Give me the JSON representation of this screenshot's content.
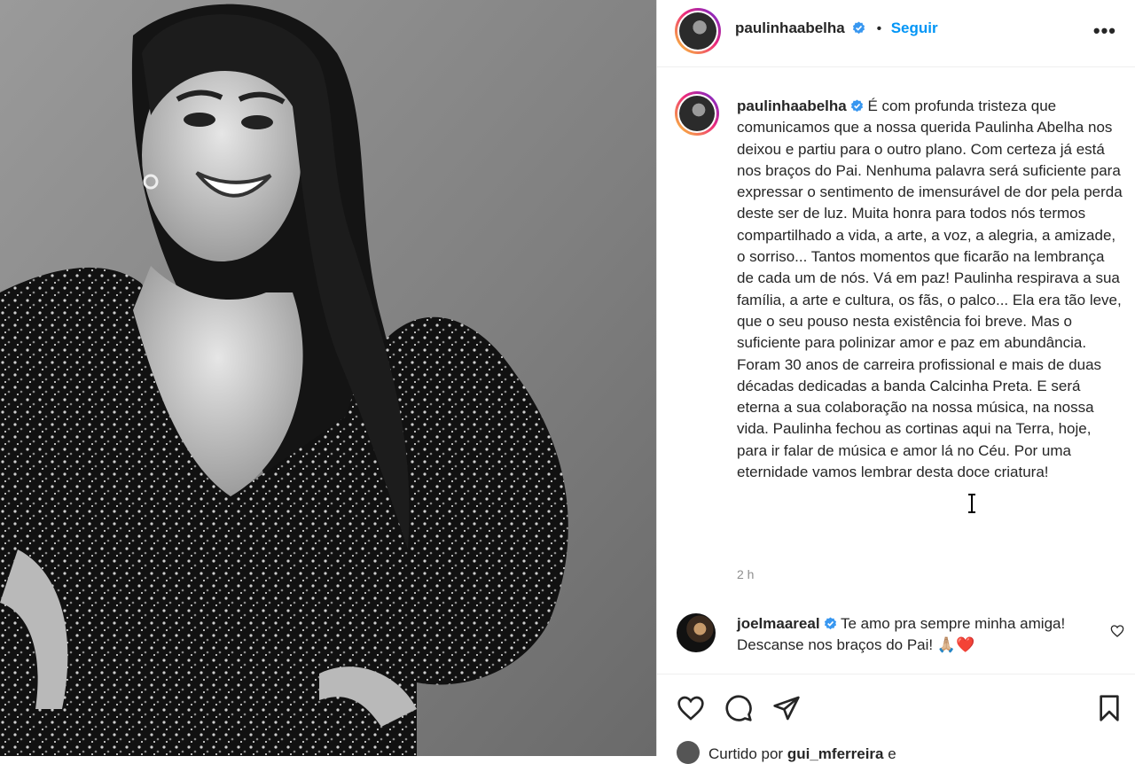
{
  "header": {
    "username": "paulinhaabelha",
    "separator": "•",
    "follow_label": "Seguir",
    "more_label": "•••"
  },
  "caption": {
    "username": "paulinhaabelha",
    "text": "É com profunda tristeza que comunicamos que a nossa querida Paulinha Abelha nos deixou e partiu para o outro plano. Com certeza já está nos braços do Pai. Nenhuma palavra será suficiente para expressar o sentimento de imensurável de dor pela perda deste ser de luz. Muita honra para todos nós termos compartilhado a vida, a arte, a voz, a alegria, a amizade, o sorriso... Tantos momentos que ficarão na lembrança de cada um de nós. Vá em paz! Paulinha respirava a sua família, a arte e cultura, os fãs, o palco... Ela era tão leve, que o seu pouso nesta existência foi breve. Mas o suficiente para polinizar amor e paz em abundância.",
    "text2": "Foram 30 anos de carreira profissional e mais de duas décadas dedicadas a banda Calcinha Preta. E será eterna a sua colaboração na nossa música, na nossa vida. Paulinha fechou as cortinas aqui na Terra, hoje, para ir falar de música e amor lá no Céu. Por uma eternidade vamos lembrar desta doce criatura!",
    "time": "2 h"
  },
  "comments": [
    {
      "username": "joelmaareal",
      "text": "Te amo pra sempre minha amiga! Descanse nos braços do Pai! 🙏🏼❤️"
    }
  ],
  "likes": {
    "prefix": "Curtido por",
    "user": "gui_mferreira",
    "suffix": "e"
  },
  "icons": [
    "verified-badge-icon",
    "heart-icon",
    "comment-icon",
    "share-icon",
    "bookmark-icon",
    "more-icon"
  ],
  "colors": {
    "accent": "#0095f6",
    "verified": "#3897f0",
    "text": "#262626",
    "muted": "#8e8e8e"
  }
}
